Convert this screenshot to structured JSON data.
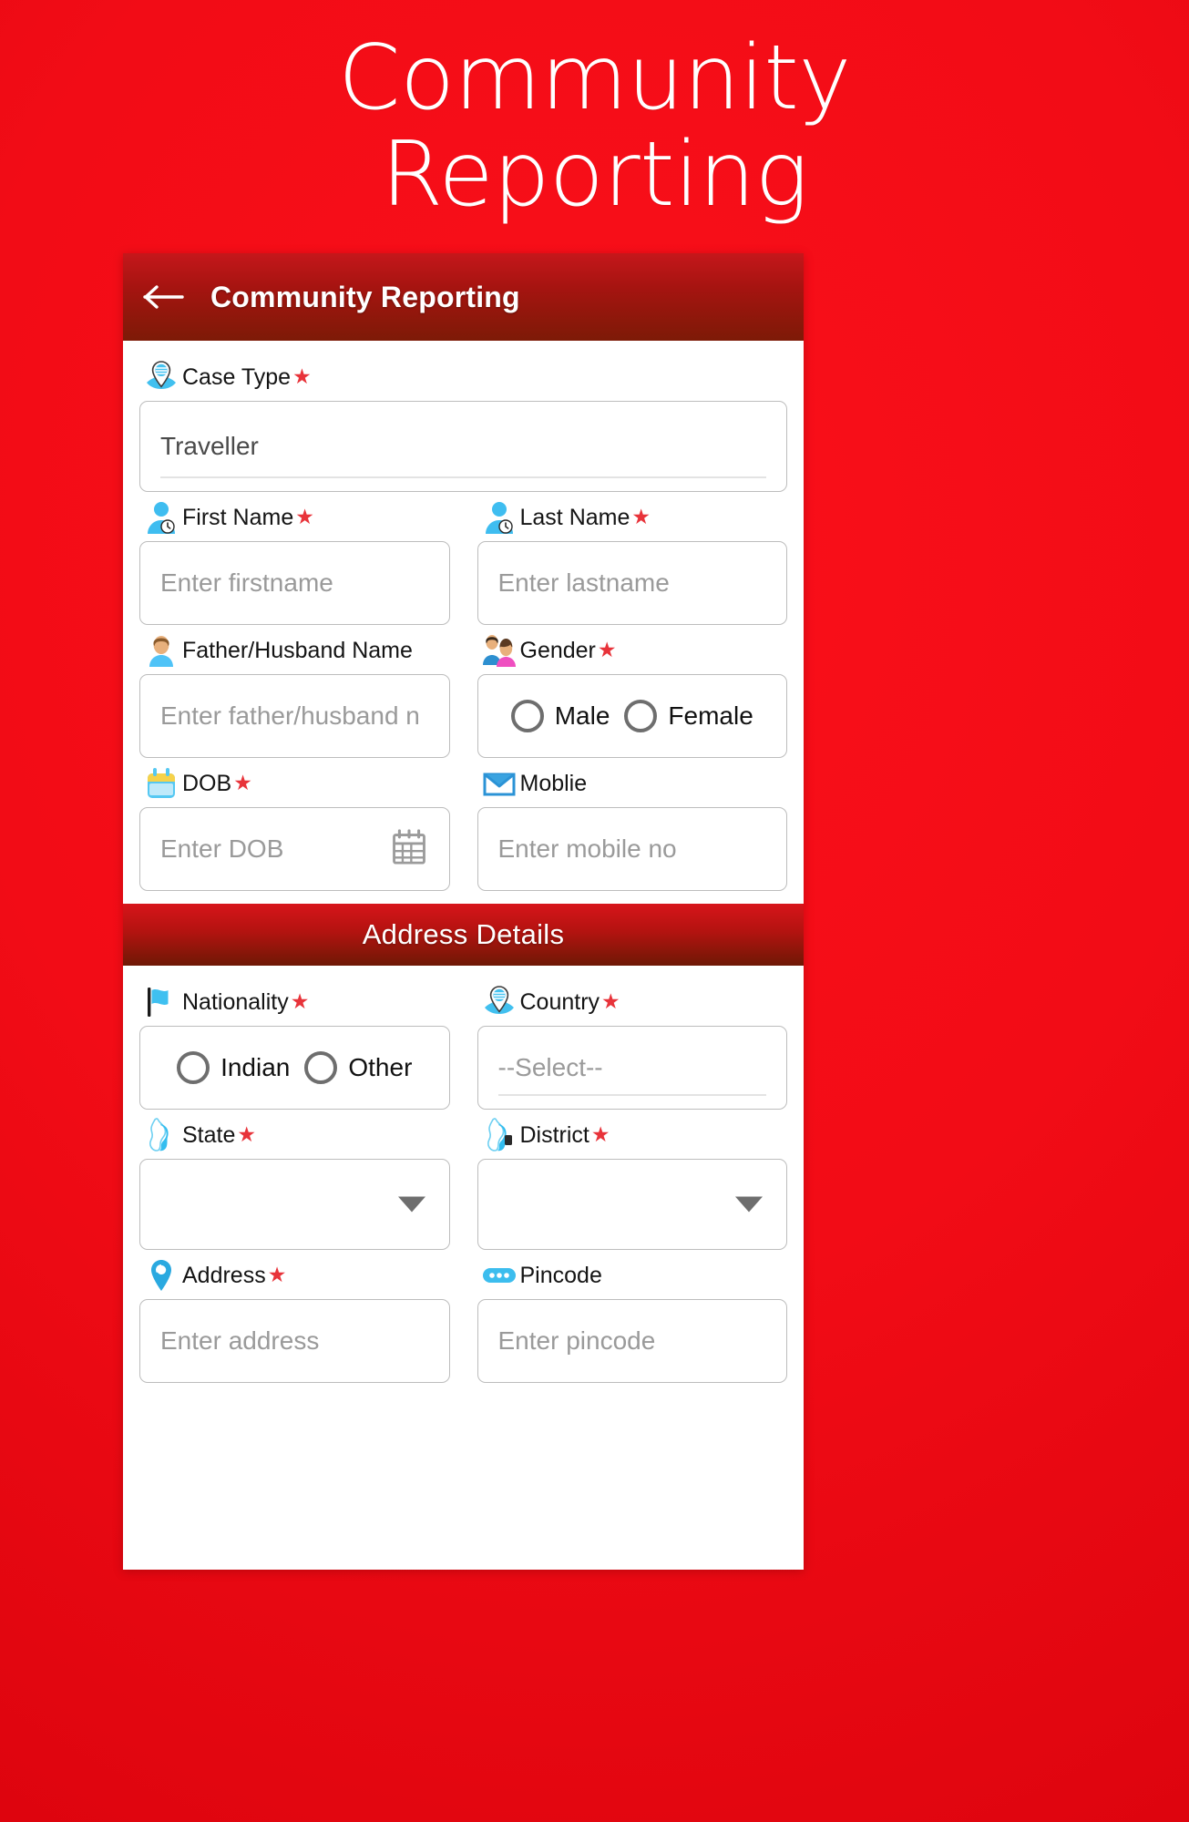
{
  "poster": {
    "line1": "Community",
    "line2": "Reporting"
  },
  "appbar": {
    "back_icon": "back-arrow-icon",
    "title": "Community Reporting"
  },
  "colors": {
    "background_red": "#f20c16",
    "appbar_dark": "#7d1a07",
    "required_star": "#e8333a",
    "placeholder": "#9a9a9a",
    "border": "#bdbdbd"
  },
  "form": {
    "case_type": {
      "label": "Case Type",
      "required_mark": "★",
      "icon": "location-pin-icon",
      "value": "Traveller"
    },
    "first_name": {
      "label": "First Name",
      "required_mark": "★",
      "icon": "user-icon",
      "placeholder": "Enter firstname",
      "value": ""
    },
    "last_name": {
      "label": "Last Name",
      "required_mark": "★",
      "icon": "user-icon",
      "placeholder": "Enter lastname",
      "value": ""
    },
    "father_husband_name": {
      "label": "Father/Husband Name",
      "required_mark": "",
      "icon": "person-icon",
      "placeholder": "Enter father/husband n",
      "value": ""
    },
    "gender": {
      "label": "Gender",
      "required_mark": "★",
      "icon": "couple-icon",
      "options": [
        {
          "label": "Male",
          "selected": false
        },
        {
          "label": "Female",
          "selected": false
        }
      ]
    },
    "dob": {
      "label": "DOB",
      "required_mark": "★",
      "icon": "calendar-icon",
      "placeholder": "Enter DOB",
      "value": "",
      "trailing_icon": "calendar-picker-icon"
    },
    "mobile": {
      "label": "Moblie",
      "required_mark": "",
      "icon": "envelope-icon",
      "placeholder": "Enter mobile no",
      "value": ""
    }
  },
  "address_section": {
    "title": "Address Details",
    "nationality": {
      "label": "Nationality",
      "required_mark": "★",
      "icon": "flag-icon",
      "options": [
        {
          "label": "Indian",
          "selected": false
        },
        {
          "label": "Other",
          "selected": false
        }
      ]
    },
    "country": {
      "label": "Country",
      "required_mark": "★",
      "icon": "location-pin-icon",
      "value": "--Select--"
    },
    "state": {
      "label": "State",
      "required_mark": "★",
      "icon": "map-icon",
      "value": "",
      "dropdown_icon": "chevron-down-icon"
    },
    "district": {
      "label": "District",
      "required_mark": "★",
      "icon": "map-icon",
      "value": "",
      "dropdown_icon": "chevron-down-icon"
    },
    "address": {
      "label": "Address",
      "required_mark": "★",
      "icon": "address-pin-icon",
      "placeholder": "Enter address",
      "value": ""
    },
    "pincode": {
      "label": "Pincode",
      "required_mark": "",
      "icon": "dots-icon",
      "placeholder": "Enter pincode",
      "value": ""
    }
  }
}
